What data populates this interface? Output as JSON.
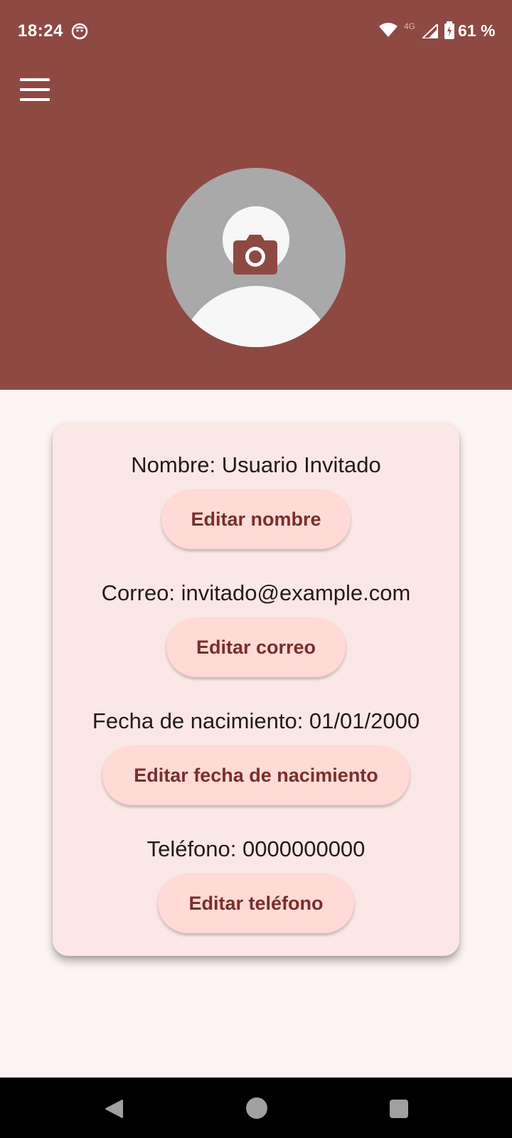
{
  "status_bar": {
    "time": "18:24",
    "network": "4G",
    "battery": "61 %",
    "icons": [
      "notification-face-icon",
      "wifi-icon",
      "signal-icon",
      "battery-charging-icon"
    ]
  },
  "header": {
    "menu_icon": "hamburger-menu-icon",
    "avatar_icon": "camera-icon",
    "color": "#8e4943"
  },
  "profile": {
    "name_text": "Nombre: Usuario Invitado",
    "name_button": "Editar nombre",
    "email_text": "Correo: invitado@example.com",
    "email_button": "Editar correo",
    "birthdate_text": "Fecha de nacimiento: 01/01/2000",
    "birthdate_button": "Editar fecha de nacimiento",
    "phone_text": "Teléfono: 0000000000",
    "phone_button": "Editar teléfono"
  },
  "colors": {
    "primary": "#8e4943",
    "card_background": "#fbe8e6",
    "button_background": "#ffdad6",
    "button_text": "#7a2e2b",
    "page_background": "#fdf4f3"
  },
  "nav_bar": {
    "icons": [
      "back-icon",
      "home-icon",
      "recents-icon"
    ]
  }
}
